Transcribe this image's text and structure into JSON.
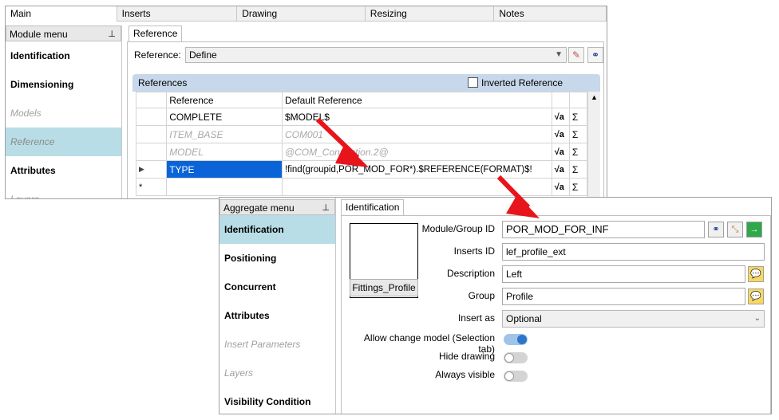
{
  "top_window": {
    "tabs": [
      "Main",
      "Inserts",
      "Drawing",
      "Resizing",
      "Notes"
    ],
    "sidebar_title": "Module menu",
    "sidebar_items": [
      {
        "label": "Identification",
        "state": "normal"
      },
      {
        "label": "Dimensioning",
        "state": "normal"
      },
      {
        "label": "Models",
        "state": "disabled"
      },
      {
        "label": "Reference",
        "state": "selected"
      },
      {
        "label": "Attributes",
        "state": "normal"
      },
      {
        "label": "Layers",
        "state": "disabled"
      }
    ],
    "subtab": "Reference",
    "reference_label": "Reference:",
    "reference_value": "Define",
    "group_title": "References",
    "inverted_label": "Inverted Reference",
    "columns": [
      "Reference",
      "Default Reference"
    ],
    "rows": [
      {
        "ref": "COMPLETE",
        "def": "$MODEL$",
        "style": "normal"
      },
      {
        "ref": "ITEM_BASE",
        "def": "COM001",
        "style": "disabled"
      },
      {
        "ref": "MODEL",
        "def": "@COM_Connection.2@",
        "style": "disabled"
      },
      {
        "ref": "TYPE",
        "def": "!find(groupid,POR_MOD_FOR*).$REFERENCE(FORMAT)$!",
        "style": "selected"
      },
      {
        "ref": "",
        "def": "",
        "style": "new"
      }
    ],
    "sigma": "Σ",
    "new_row_marker": "*",
    "current_row_marker": "▶"
  },
  "bottom_window": {
    "sidebar_title": "Aggregate menu",
    "sidebar_items": [
      {
        "label": "Identification",
        "state": "selected"
      },
      {
        "label": "Positioning",
        "state": "normal"
      },
      {
        "label": "Concurrent",
        "state": "normal"
      },
      {
        "label": "Attributes",
        "state": "normal"
      },
      {
        "label": "Insert Parameters",
        "state": "disabled"
      },
      {
        "label": "Layers",
        "state": "disabled"
      },
      {
        "label": "Visibility Condition",
        "state": "normal"
      }
    ],
    "subtab": "Identification",
    "preview_button": "Fittings_Profile",
    "fields": {
      "module_group_id_label": "Module/Group ID",
      "module_group_id_value": "POR_MOD_FOR_INF",
      "inserts_id_label": "Inserts ID",
      "inserts_id_value": "lef_profile_ext",
      "description_label": "Description",
      "description_value": "Left",
      "group_label": "Group",
      "group_value": "Profile",
      "insert_as_label": "Insert as",
      "insert_as_value": "Optional"
    },
    "toggles": [
      {
        "label": "Allow change model (Selection tab)",
        "on": true
      },
      {
        "label": "Hide drawing",
        "on": false
      },
      {
        "label": "Always visible",
        "on": false
      }
    ]
  },
  "colors": {
    "annotation_arrow": "#e8141c",
    "selection": "#0a64d8",
    "sidebar_selected": "#b8dde6",
    "toggle_on": "#2e75c8"
  },
  "icons": [
    "pin-icon",
    "eraser-icon",
    "binoculars-icon",
    "sqrt-icon",
    "sigma-icon",
    "chevron-down-icon",
    "scroll-up-icon",
    "cursor-select-icon",
    "green-arrow-icon",
    "speech-bubble-icon"
  ]
}
